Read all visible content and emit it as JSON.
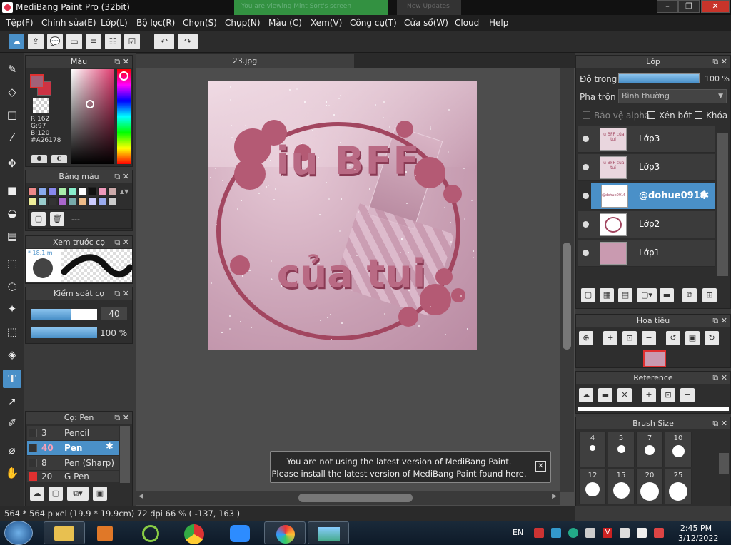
{
  "window": {
    "title": "MediBang Paint Pro (32bit)",
    "ghost_text_1": "You are viewing Mint Sort's screen",
    "ghost_text_2": "New Updates"
  },
  "menu": [
    "Tệp(F)",
    "Chỉnh sửa(E)",
    "Lớp(L)",
    "Bộ lọc(R)",
    "Chọn(S)",
    "Chụp(N)",
    "Màu (C)",
    "Xem(V)",
    "Công cụ(T)",
    "Cửa sổ(W)",
    "Cloud",
    "Help"
  ],
  "color_panel": {
    "title": "Màu",
    "r": "R:162",
    "g": "G:97",
    "b": "B:120",
    "hex": "#A26178",
    "primary_color": "#a26178",
    "secondary_color": "#cc3344"
  },
  "palette_panel": {
    "title": "Bảng màu",
    "swatches": [
      "#e88",
      "#8ae",
      "#88e",
      "#aea",
      "#8ec",
      "#fff",
      "#111",
      "#e9b",
      "#caa",
      "#ee9",
      "#9cc",
      "#333",
      "#a6c",
      "#7aa",
      "#eb8",
      "#ccf",
      "#9ae",
      "#ccc"
    ],
    "placeholder": "---"
  },
  "preview_panel": {
    "title": "Xem trước cọ",
    "size_label": "* 18.1Im"
  },
  "brush_control": {
    "title": "Kiểm soát cọ",
    "size_value": "40",
    "opacity_value": "100 %",
    "size_level": 0.6,
    "opacity_level": 1.0
  },
  "brush_list": {
    "title": "Cọ: Pen",
    "items": [
      {
        "size": "3",
        "name": "Pencil",
        "color": "#333"
      },
      {
        "size": "40",
        "name": "Pen",
        "color": "#333"
      },
      {
        "size": "8",
        "name": "Pen (Sharp)",
        "color": "#333"
      },
      {
        "size": "20",
        "name": "G Pen",
        "color": "#e03030"
      }
    ]
  },
  "canvas": {
    "tab": "23.jpg",
    "art_text_1": "iu BFF",
    "art_text_2": "của tui"
  },
  "notice": {
    "line1": "You are not using the latest version of MediBang Paint.",
    "line2": "Please install the latest version of MediBang Paint found here."
  },
  "layer_panel": {
    "title": "Lớp",
    "opacity_label": "Độ trong",
    "opacity_value": "100 %",
    "blend_label": "Pha trộn",
    "blend_value": "Bình thường",
    "protect_alpha": "Bảo vệ alpha",
    "clipping": "Xén bớt",
    "lock": "Khóa",
    "layers": [
      {
        "name": "Lớp3",
        "thumb_text": "iu BFF của tui"
      },
      {
        "name": "Lớp3",
        "thumb_text": "iu BFF của tui"
      },
      {
        "name": "@dohue0916",
        "thumb_text": "@dohue0916"
      },
      {
        "name": "Lớp2",
        "thumb_text": ""
      },
      {
        "name": "Lớp1",
        "thumb_text": ""
      }
    ]
  },
  "navigator": {
    "title": "Hoa tiêu"
  },
  "reference": {
    "title": "Reference"
  },
  "brush_size_panel": {
    "title": "Brush Size",
    "sizes": [
      "4",
      "5",
      "7",
      "10",
      "12",
      "15",
      "20",
      "25"
    ]
  },
  "status": "564 * 564 pixel  (19.9 * 19.9cm)  72 dpi  66 %  ( -137, 163 )",
  "taskbar": {
    "lang": "EN",
    "time": "2:45 PM",
    "date": "3/12/2022"
  }
}
